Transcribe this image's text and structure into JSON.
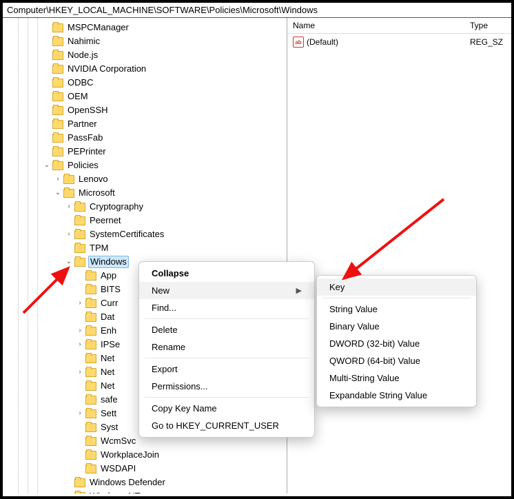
{
  "address": "Computer\\HKEY_LOCAL_MACHINE\\SOFTWARE\\Policies\\Microsoft\\Windows",
  "val_head": {
    "name": "Name",
    "type": "Type"
  },
  "val_rows": [
    {
      "icon": "ab",
      "name": "(Default)",
      "type": "REG_SZ"
    }
  ],
  "tree": [
    {
      "d": 3,
      "e": "",
      "l": "MSPCManager"
    },
    {
      "d": 3,
      "e": "",
      "l": "Nahimic"
    },
    {
      "d": 3,
      "e": "",
      "l": "Node.js"
    },
    {
      "d": 3,
      "e": "",
      "l": "NVIDIA Corporation"
    },
    {
      "d": 3,
      "e": "",
      "l": "ODBC"
    },
    {
      "d": 3,
      "e": "",
      "l": "OEM"
    },
    {
      "d": 3,
      "e": "",
      "l": "OpenSSH"
    },
    {
      "d": 3,
      "e": "",
      "l": "Partner"
    },
    {
      "d": 3,
      "e": "",
      "l": "PassFab"
    },
    {
      "d": 3,
      "e": "",
      "l": "PEPrinter"
    },
    {
      "d": 3,
      "e": "v",
      "l": "Policies"
    },
    {
      "d": 4,
      "e": ">",
      "l": "Lenovo"
    },
    {
      "d": 4,
      "e": "v",
      "l": "Microsoft"
    },
    {
      "d": 5,
      "e": ">",
      "l": "Cryptography"
    },
    {
      "d": 5,
      "e": "",
      "l": "Peernet"
    },
    {
      "d": 5,
      "e": ">",
      "l": "SystemCertificates"
    },
    {
      "d": 5,
      "e": "",
      "l": "TPM"
    },
    {
      "d": 5,
      "e": "v",
      "l": "Windows",
      "sel": true
    },
    {
      "d": 6,
      "e": "",
      "l": "App"
    },
    {
      "d": 6,
      "e": "",
      "l": "BITS"
    },
    {
      "d": 6,
      "e": ">",
      "l": "Curr"
    },
    {
      "d": 6,
      "e": "",
      "l": "Dat"
    },
    {
      "d": 6,
      "e": ">",
      "l": "Enh"
    },
    {
      "d": 6,
      "e": ">",
      "l": "IPSe"
    },
    {
      "d": 6,
      "e": "",
      "l": "Net"
    },
    {
      "d": 6,
      "e": ">",
      "l": "Net"
    },
    {
      "d": 6,
      "e": "",
      "l": "Net"
    },
    {
      "d": 6,
      "e": "",
      "l": "safe"
    },
    {
      "d": 6,
      "e": ">",
      "l": "Sett"
    },
    {
      "d": 6,
      "e": "",
      "l": "Syst"
    },
    {
      "d": 6,
      "e": "",
      "l": "WcmSvc"
    },
    {
      "d": 6,
      "e": "",
      "l": "WorkplaceJoin"
    },
    {
      "d": 6,
      "e": "",
      "l": "WSDAPI"
    },
    {
      "d": 5,
      "e": "",
      "l": "Windows Defender"
    },
    {
      "d": 5,
      "e": "",
      "l": "Windows NT"
    }
  ],
  "ctx1": {
    "collapse": "Collapse",
    "new": "New",
    "find": "Find...",
    "delete": "Delete",
    "rename": "Rename",
    "export": "Export",
    "perms": "Permissions...",
    "copy": "Copy Key Name",
    "goto": "Go to HKEY_CURRENT_USER"
  },
  "ctx2": {
    "key": "Key",
    "string": "String Value",
    "binary": "Binary Value",
    "dword": "DWORD (32-bit) Value",
    "qword": "QWORD (64-bit) Value",
    "multi": "Multi-String Value",
    "exp": "Expandable String Value"
  }
}
